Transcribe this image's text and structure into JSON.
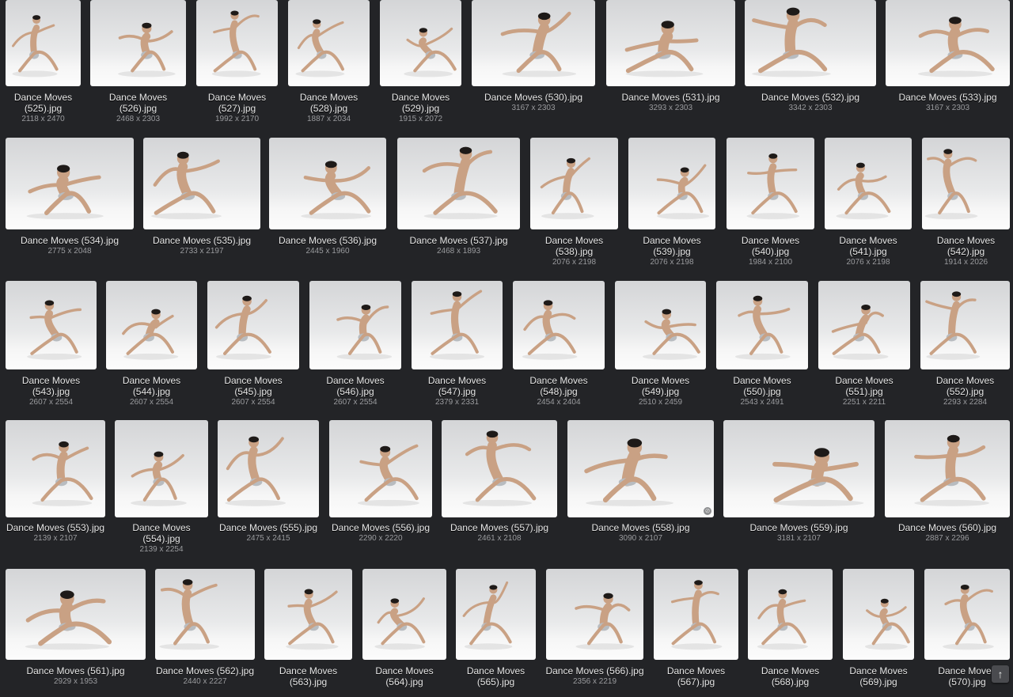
{
  "gallery": {
    "items": [
      {
        "name": "Dance Moves\n(525).jpg",
        "dims": "2118 x 2470"
      },
      {
        "name": "Dance Moves\n(526).jpg",
        "dims": "2468 x 2303"
      },
      {
        "name": "Dance Moves\n(527).jpg",
        "dims": "1992 x 2170"
      },
      {
        "name": "Dance Moves\n(528).jpg",
        "dims": "1887 x 2034"
      },
      {
        "name": "Dance Moves\n(529).jpg",
        "dims": "1915 x 2072"
      },
      {
        "name": "Dance Moves (530).jpg",
        "dims": "3167 x 2303"
      },
      {
        "name": "Dance Moves (531).jpg",
        "dims": "3293 x 2303"
      },
      {
        "name": "Dance Moves (532).jpg",
        "dims": "3342 x 2303"
      },
      {
        "name": "Dance Moves (533).jpg",
        "dims": "3167 x 2303"
      },
      {
        "name": "Dance Moves (534).jpg",
        "dims": "2775 x 2048"
      },
      {
        "name": "Dance Moves (535).jpg",
        "dims": "2733 x 2197"
      },
      {
        "name": "Dance Moves (536).jpg",
        "dims": "2445 x 1960"
      },
      {
        "name": "Dance Moves (537).jpg",
        "dims": "2468 x 1893"
      },
      {
        "name": "Dance Moves\n(538).jpg",
        "dims": "2076 x 2198"
      },
      {
        "name": "Dance Moves\n(539).jpg",
        "dims": "2076 x 2198"
      },
      {
        "name": "Dance Moves\n(540).jpg",
        "dims": "1984 x 2100"
      },
      {
        "name": "Dance Moves\n(541).jpg",
        "dims": "2076 x 2198"
      },
      {
        "name": "Dance Moves\n(542).jpg",
        "dims": "1914 x 2026"
      },
      {
        "name": "Dance Moves\n(543).jpg",
        "dims": "2607 x 2554"
      },
      {
        "name": "Dance Moves\n(544).jpg",
        "dims": "2607 x 2554"
      },
      {
        "name": "Dance Moves\n(545).jpg",
        "dims": "2607 x 2554"
      },
      {
        "name": "Dance Moves\n(546).jpg",
        "dims": "2607 x 2554"
      },
      {
        "name": "Dance Moves\n(547).jpg",
        "dims": "2379 x 2331"
      },
      {
        "name": "Dance Moves\n(548).jpg",
        "dims": "2454 x 2404"
      },
      {
        "name": "Dance Moves\n(549).jpg",
        "dims": "2510 x 2459"
      },
      {
        "name": "Dance Moves\n(550).jpg",
        "dims": "2543 x 2491"
      },
      {
        "name": "Dance Moves\n(551).jpg",
        "dims": "2251 x 2211"
      },
      {
        "name": "Dance Moves\n(552).jpg",
        "dims": "2293 x 2284"
      },
      {
        "name": "Dance Moves (553).jpg",
        "dims": "2139 x 2107"
      },
      {
        "name": "Dance Moves\n(554).jpg",
        "dims": "2139 x 2254"
      },
      {
        "name": "Dance Moves (555).jpg",
        "dims": "2475 x 2415"
      },
      {
        "name": "Dance Moves (556).jpg",
        "dims": "2290 x 2220"
      },
      {
        "name": "Dance Moves (557).jpg",
        "dims": "2461 x 2108"
      },
      {
        "name": "Dance Moves (558).jpg",
        "dims": "3090 x 2107"
      },
      {
        "name": "Dance Moves (559).jpg",
        "dims": "3181 x 2107"
      },
      {
        "name": "Dance Moves (560).jpg",
        "dims": "2887 x 2296"
      },
      {
        "name": "Dance Moves (561).jpg",
        "dims": "2929 x 1953"
      },
      {
        "name": "Dance Moves (562).jpg",
        "dims": "2440 x 2227"
      },
      {
        "name": "Dance Moves\n(563).jpg",
        "dims": ""
      },
      {
        "name": "Dance Moves\n(564).jpg",
        "dims": ""
      },
      {
        "name": "Dance Moves\n(565).jpg",
        "dims": ""
      },
      {
        "name": "Dance Moves (566).jpg",
        "dims": "2356 x 2219"
      },
      {
        "name": "Dance Moves\n(567).jpg",
        "dims": ""
      },
      {
        "name": "Dance Moves\n(568).jpg",
        "dims": ""
      },
      {
        "name": "Dance Moves\n(569).jpg",
        "dims": ""
      },
      {
        "name": "Dance Moves\n(570).jpg",
        "dims": ""
      }
    ]
  },
  "scroll_top": {
    "icon": "arrow-up-icon",
    "glyph": "🡑"
  },
  "colors": {
    "background": "#232427",
    "name_text": "#e6e6e6",
    "dims_text": "#9a9b9e"
  }
}
